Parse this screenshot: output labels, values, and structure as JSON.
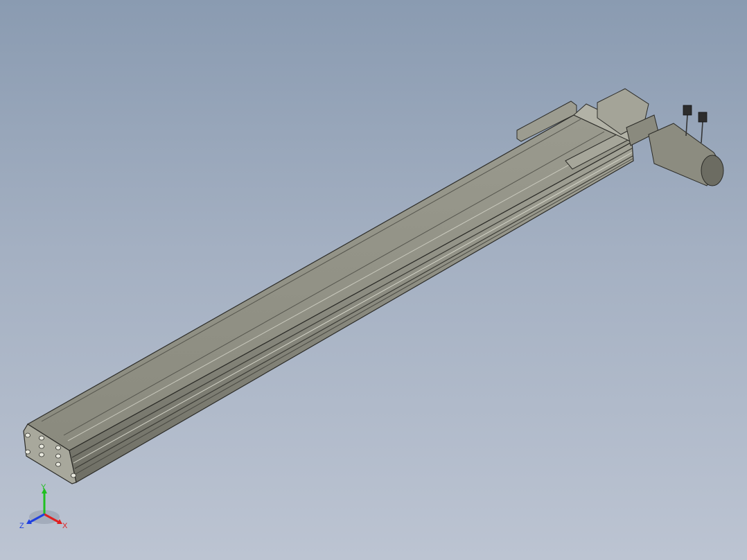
{
  "viewport": {
    "background_top": "#8a9bb1",
    "background_bottom": "#bcc4d2"
  },
  "model": {
    "body_color": "#8f8f83",
    "edge_color": "#2b2b27"
  },
  "triad": {
    "x_label": "X",
    "y_label": "Y",
    "z_label": "Z",
    "x_color": "#e02020",
    "y_color": "#20c020",
    "z_color": "#2040e0"
  }
}
